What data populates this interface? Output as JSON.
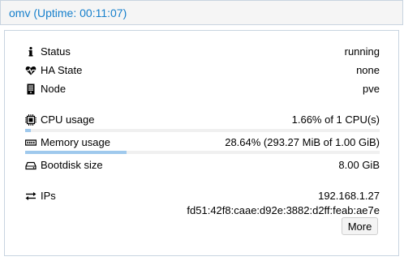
{
  "panel": {
    "title": "omv (Uptime: 00:11:07)"
  },
  "status": {
    "status_label": "Status",
    "status_value": "running",
    "ha_label": "HA State",
    "ha_value": "none",
    "node_label": "Node",
    "node_value": "pve"
  },
  "resources": {
    "cpu_label": "CPU usage",
    "cpu_value": "1.66% of 1 CPU(s)",
    "cpu_fraction": 0.0166,
    "memory_label": "Memory usage",
    "memory_value": "28.64% (293.27 MiB of 1.00 GiB)",
    "memory_fraction": 0.2864,
    "bootdisk_label": "Bootdisk size",
    "bootdisk_value": "8.00 GiB"
  },
  "network": {
    "ips_label": "IPs",
    "ip_v4": "192.168.1.27",
    "ip_v6": "fd51:42f8:caae:d92e:3882:d2ff:feab:ae7e",
    "more_label": "More"
  },
  "colors": {
    "title": "#157fcc",
    "border": "#c8d4e0",
    "bar_fill": "#9fc9ed",
    "bar_track": "#f0f0f0"
  },
  "icons": {
    "status": "info-icon",
    "ha": "heartbeat-icon",
    "node": "server-icon",
    "cpu": "cpu-chip-icon",
    "memory": "memory-icon",
    "bootdisk": "hard-drive-icon",
    "ips": "exchange-arrows-icon"
  }
}
